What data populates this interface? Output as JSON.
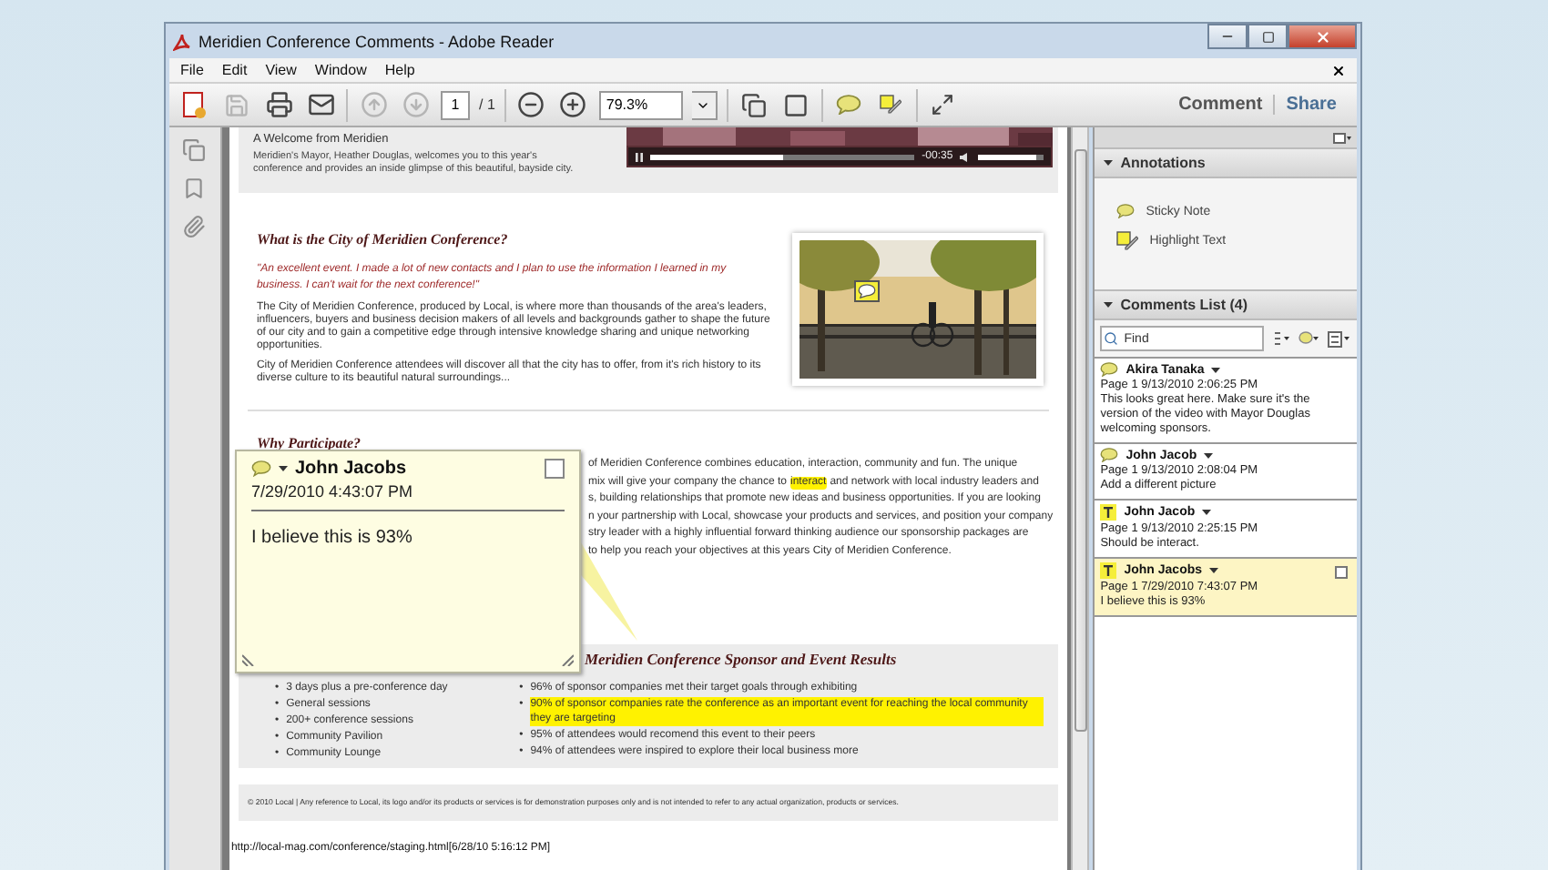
{
  "window": {
    "title": "Meridien Conference Comments - Adobe Reader"
  },
  "menu": [
    "File",
    "Edit",
    "View",
    "Window",
    "Help"
  ],
  "toolbar": {
    "page": "1",
    "page_total": "/ 1",
    "zoom": "79.3%",
    "buttons": [
      "Comment",
      "Share"
    ]
  },
  "document": {
    "welcome": {
      "title": "A Welcome from Meridien",
      "text": "Meridien's Mayor, Heather Douglas, welcomes you to this year's conference and provides an inside glimpse of this beautiful, bayside city.",
      "video_time": "-00:35",
      "progress": {
        "level": 0.5
      },
      "volume": {
        "level": 0.9
      }
    },
    "about": {
      "heading": "What is the City of Meridien Conference?",
      "quote": "\"An excellent event. I made a lot of new contacts and I plan to use the information I learned in my business. I can't wait for the next conference!\"",
      "paragraphs": [
        "The City of Meridien Conference, produced by Local, is where more than thousands of the area's leaders, influencers, buyers and business decision makers of all levels and backgrounds gather to shape the future of our city and to gain a competitive edge through intensive knowledge sharing and unique networking opportunities.",
        "City of Meridien Conference attendees will discover all that the city has to offer, from it's rich history to its diverse culture to its beautiful natural surroundings..."
      ]
    },
    "participate": {
      "heading": "Why Participate?",
      "lines": [
        [
          {
            "text": "of Meridien Conference combines education, interaction, community and fun. The unique",
            "highlighted": false
          }
        ],
        [
          {
            "text": "mix will give your company the chance to",
            "highlighted": false
          },
          {
            "text": "interact",
            "highlighted": true
          },
          {
            "text": "and network with local industry leaders and",
            "highlighted": false
          }
        ],
        [
          {
            "text": "s, building relationships that promote new ideas and business opportunities. If you are looking",
            "highlighted": false
          }
        ],
        [
          {
            "text": "n your partnership with Local, showcase your products and services, and position your company",
            "highlighted": false
          }
        ],
        [
          {
            "text": "stry leader with a highly influential forward thinking audience our sponsorship packages are",
            "highlighted": false
          }
        ],
        [
          {
            "text": "to help you reach your objectives at this years City of Meridien Conference.",
            "highlighted": false
          }
        ]
      ]
    },
    "results": {
      "heading": "Meridien Conference Sponsor and Event Results",
      "marker": "•",
      "left": [
        "3 days plus a pre-conference day",
        "General sessions",
        "200+ conference sessions",
        "Community Pavilion",
        "Community Lounge"
      ],
      "right": [
        {
          "text": "96% of sponsor companies met their target goals through exhibiting",
          "highlighted": false
        },
        {
          "text": "90% of sponsor companies rate the conference as an important event for reaching the local community they are targeting",
          "highlighted": true
        },
        {
          "text": "95% of attendees would recomend this event to their peers",
          "highlighted": false
        },
        {
          "text": "94% of attendees were inspired to explore their local business more",
          "highlighted": false
        }
      ]
    },
    "footer": "© 2010 Local | Any reference to Local, its logo and/or its products or services is for demonstration purposes only and is not intended to refer to any actual organization, products or services.",
    "url": "http://local-mag.com/conference/staging.html[6/28/10 5:16:12 PM]"
  },
  "note_popup": {
    "author": "John Jacobs",
    "date": "7/29/2010 4:43:07 PM",
    "text": "I believe this is 93%"
  },
  "panel": {
    "annotations": {
      "title": "Annotations",
      "expanded": true,
      "tools": [
        {
          "kind": "note",
          "label": "Sticky Note"
        },
        {
          "kind": "highlight",
          "label": "Highlight Text"
        }
      ]
    },
    "comments": {
      "title": "Comments List (4)",
      "expanded": true,
      "search_placeholder": "Find",
      "items": [
        {
          "kind": "note",
          "author": "Akira Tanaka",
          "meta": "Page 1  9/13/2010 2:06:25 PM",
          "text": "This looks great here. Make sure it's the version of the video with Mayor Douglas welcoming sponsors.",
          "selected": false
        },
        {
          "kind": "note",
          "author": "John Jacob",
          "meta": "Page 1  9/13/2010 2:08:04 PM",
          "text": "Add a different picture",
          "selected": false
        },
        {
          "kind": "text",
          "author": "John Jacob",
          "meta": "Page 1  9/13/2010 2:25:15 PM",
          "text": "Should be interact.",
          "selected": false
        },
        {
          "kind": "text",
          "author": "John Jacobs",
          "meta": "Page 1  7/29/2010 7:43:07 PM",
          "text": "I believe this is 93%",
          "selected": true
        }
      ]
    }
  }
}
